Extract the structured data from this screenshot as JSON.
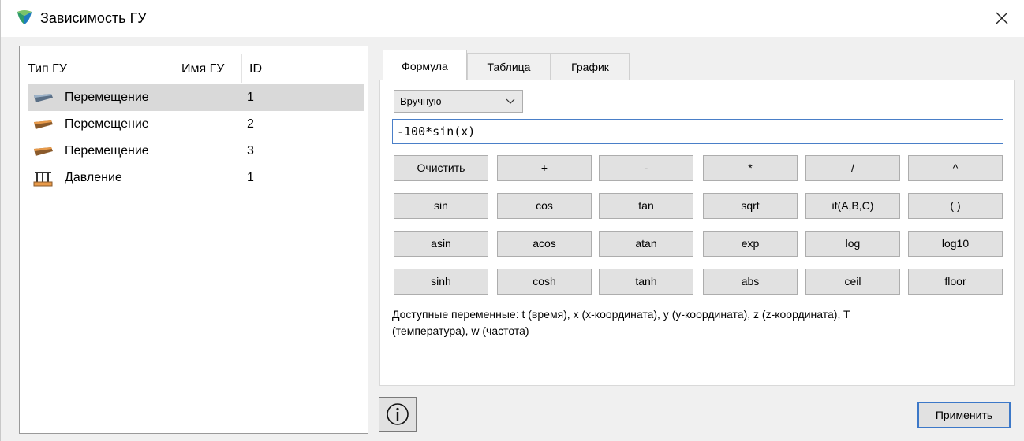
{
  "window": {
    "title": "Зависимость ГУ",
    "accent": "#3c78c8"
  },
  "list": {
    "headers": {
      "type": "Тип ГУ",
      "name": "Имя ГУ",
      "id": "ID"
    },
    "rows": [
      {
        "type": "Перемещение",
        "id": "1",
        "icon": "displacement-icon",
        "selected": true
      },
      {
        "type": "Перемещение",
        "id": "2",
        "icon": "displacement-icon",
        "selected": false
      },
      {
        "type": "Перемещение",
        "id": "3",
        "icon": "displacement-icon",
        "selected": false
      },
      {
        "type": "Давление",
        "id": "1",
        "icon": "pressure-icon",
        "selected": false
      }
    ]
  },
  "tabs": [
    {
      "label": "Формула",
      "active": true
    },
    {
      "label": "Таблица",
      "active": false
    },
    {
      "label": "График",
      "active": false
    }
  ],
  "formula": {
    "mode": "Вручную",
    "expression": "-100*sin(x)",
    "buttons": [
      [
        "Очистить",
        "+",
        "-",
        "*",
        "/",
        "^"
      ],
      [
        "sin",
        "cos",
        "tan",
        "sqrt",
        "if(A,B,C)",
        "(  )"
      ],
      [
        "asin",
        "acos",
        "atan",
        "exp",
        "log",
        "log10"
      ],
      [
        "sinh",
        "cosh",
        "tanh",
        "abs",
        "ceil",
        "floor"
      ]
    ],
    "vars_line1": "Доступные переменные: t (время), x (x-координата), y (y-координата), z (z-координата), T",
    "vars_line2": "(температура), w (частота)"
  },
  "footer": {
    "apply_label": "Применить",
    "info_icon": "info-icon"
  }
}
